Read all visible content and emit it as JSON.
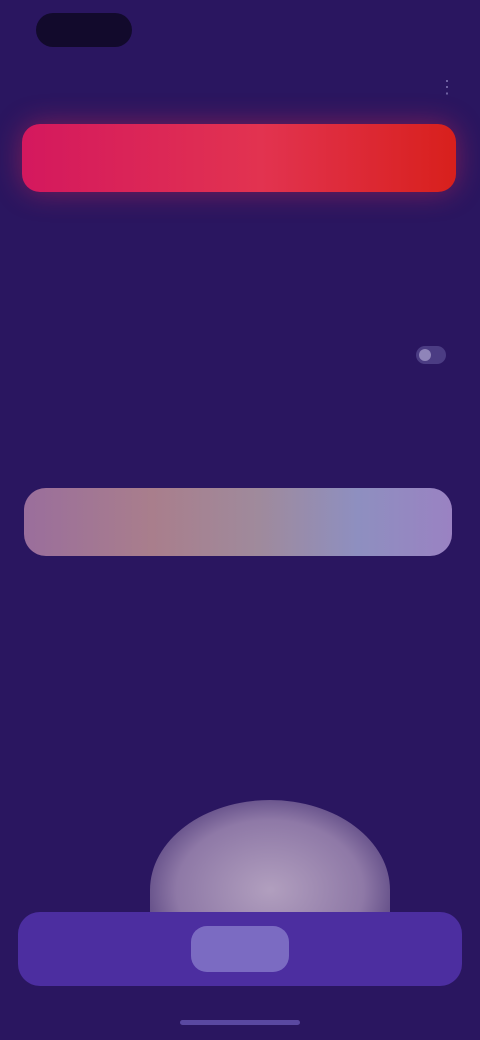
{
  "status_bar": {
    "time": "",
    "right": ""
  },
  "header": {
    "title": "",
    "action_icon": "more-icon"
  },
  "hero_button": {
    "label": "",
    "gradient_start": "#d4185e",
    "gradient_end": "#d8201c"
  },
  "section1": {
    "row1_label": "",
    "row1_subtext": "",
    "row2_label": "",
    "row3_label": "",
    "row3_value": ""
  },
  "gradient_card": {
    "label": ""
  },
  "section2": {
    "heading": "",
    "row1_label": "",
    "row1_value": "",
    "row2_label": "",
    "row2_value": "",
    "row3_label": "",
    "row3_value": ""
  },
  "bottom_nav": {
    "center_label": ""
  },
  "colors": {
    "background": "#2a1660",
    "nav": "#4c2ea0",
    "accent": "#e23350"
  }
}
